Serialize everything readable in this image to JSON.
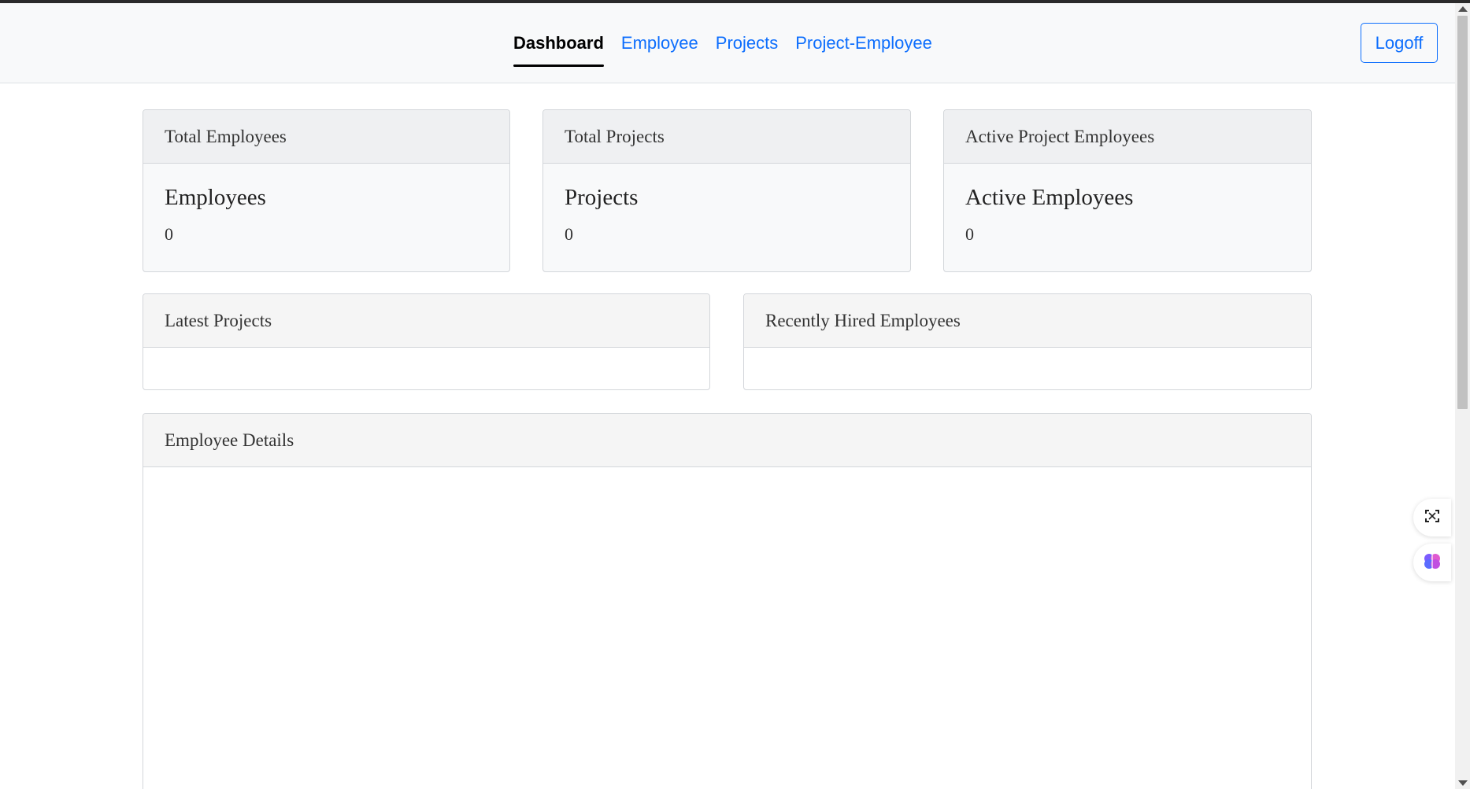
{
  "nav": {
    "links": [
      {
        "label": "Dashboard",
        "active": true
      },
      {
        "label": "Employee",
        "active": false
      },
      {
        "label": "Projects",
        "active": false
      },
      {
        "label": "Project-Employee",
        "active": false
      }
    ],
    "logoff_label": "Logoff"
  },
  "stats": [
    {
      "header": "Total Employees",
      "title": "Employees",
      "value": "0"
    },
    {
      "header": "Total Projects",
      "title": "Projects",
      "value": "0"
    },
    {
      "header": "Active Project Employees",
      "title": "Active Employees",
      "value": "0"
    }
  ],
  "panels": {
    "latest_projects": "Latest Projects",
    "recently_hired": "Recently Hired Employees",
    "employee_details": "Employee Details"
  },
  "side_tools": {
    "icons": [
      "screenshot-tool-icon",
      "brain-assistant-icon"
    ]
  },
  "colors": {
    "accent": "#0d6efd",
    "navbar_bg": "#f8f9fa"
  }
}
